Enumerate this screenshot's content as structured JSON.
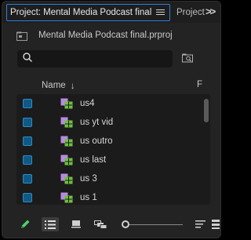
{
  "tabs": {
    "active_label": "Project: Mental Media Podcast final",
    "inactive_label": "Project",
    "overflow_label": ">>"
  },
  "project": {
    "file_name": "Mental Media Podcast final.prproj"
  },
  "search": {
    "value": "",
    "placeholder": ""
  },
  "columns": {
    "name_label": "Name",
    "second_label": "F"
  },
  "items": [
    {
      "label": "us4"
    },
    {
      "label": "us yt vid"
    },
    {
      "label": "us outro"
    },
    {
      "label": "us last"
    },
    {
      "label": "us 3"
    },
    {
      "label": "us 1"
    }
  ],
  "colors": {
    "accent": "#2d7fdd",
    "checkbox": "#0f5a84",
    "sequence_icon": "#6fbf3f",
    "sequence_icon_frame": "#b98be0",
    "pencil": "#4fd06f"
  },
  "icons": {
    "search": "search-icon",
    "bin_search": "find-in-bin-icon",
    "pencil": "pencil-icon",
    "list_view": "list-view-icon",
    "icon_view": "icon-view-icon",
    "freeform_view": "freeform-view-icon",
    "menu": "panel-menu-icon"
  }
}
